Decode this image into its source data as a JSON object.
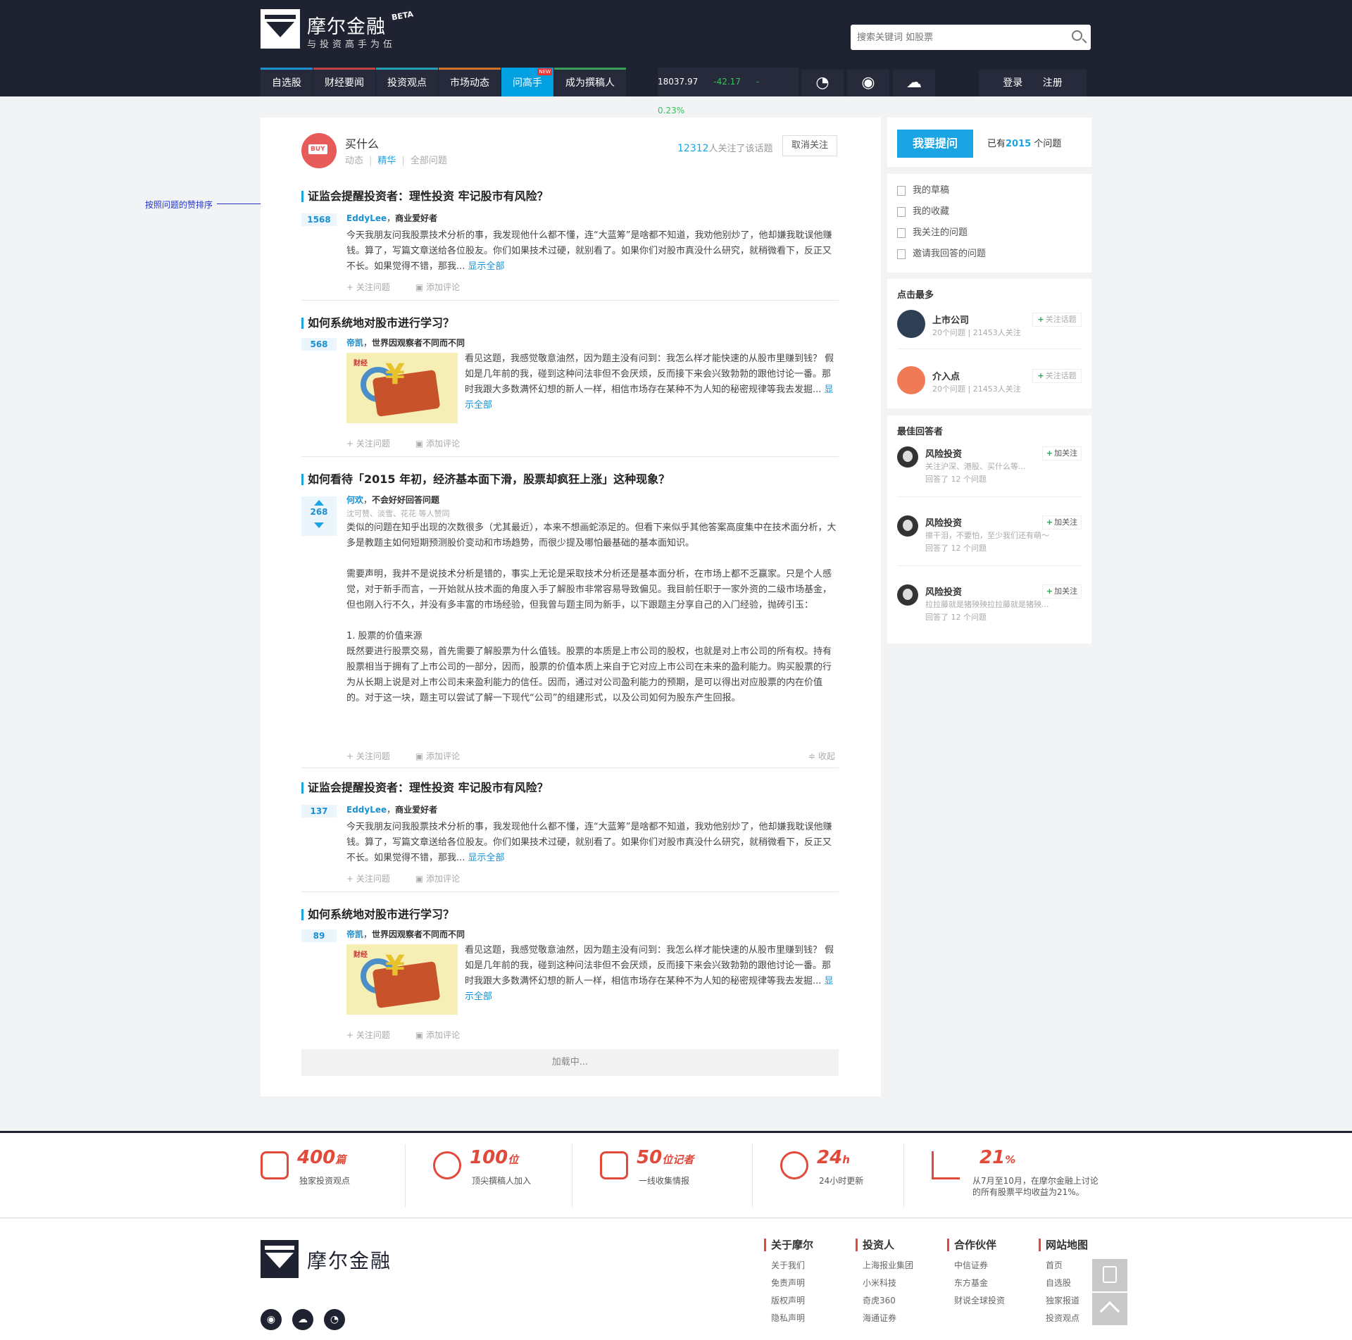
{
  "header": {
    "brand": "摩尔金融",
    "beta": "BETA",
    "slogan": "与投资高手为伍",
    "search_placeholder": "搜索关键词 如股票",
    "nav": [
      "自选股",
      "财经要闻",
      "投资观点",
      "市场动态",
      "问高手",
      "成为撰稿人"
    ],
    "nav_new_badge": "NEW",
    "ticker": {
      "index": "18037.97",
      "change": "-42.17",
      "percent": "-0.23%"
    },
    "login": "登录",
    "register": "注册"
  },
  "topic": {
    "name": "买什么",
    "tabs": [
      "动态",
      "精华",
      "全部问题"
    ],
    "follow_count": "12312",
    "follow_suffix": "人关注了该话题",
    "unfollow": "取消关注"
  },
  "annotation": "按照问题的赞排序",
  "actions": {
    "follow": "关注问题",
    "comment": "添加评论",
    "collapse": "收起",
    "show_all": "显示全部"
  },
  "questions": [
    {
      "title": "证监会提醒投资者：理性投资 牢记股市有风险？",
      "votes": "1568",
      "author": "EddyLee",
      "author_desc": "商业爱好者",
      "text": "今天我朋友问我股票技术分析的事，我发现他什么都不懂，连“大蓝筹”是啥都不知道，我劝他别炒了，他却嫌我耽误他赚钱。算了，写篇文章送给各位股友。你们如果技术过硬，就别看了。如果你们对股市真没什么研究，就稍微看下，反正又不长。如果觉得不错，那我..."
    },
    {
      "title": "如何系统地对股市进行学习？",
      "votes": "568",
      "author": "帝凯",
      "author_desc": "世界因观察者不同而不同",
      "text": "看见这题，我感觉敬意油然，因为题主没有问到：我怎么样才能快速的从股市里赚到钱？ 假如是几年前的我，碰到这种问法非但不会厌烦，反而接下来会兴致勃勃的跟他讨论一番。那时我跟大多数满怀幻想的新人一样，相信市场存在某种不为人知的秘密规律等我去发掘..."
    },
    {
      "title": "如何看待「2015 年初，经济基本面下滑，股票却疯狂上涨」这种现象？",
      "votes": "268",
      "author": "何欢",
      "author_desc": "不会好好回答问题",
      "likers": "沈可赞、淡雪、花花 等人赞同",
      "paragraphs": [
        "类似的问题在知乎出现的次数很多（尤其最近），本来不想画蛇添足的。但看下来似乎其他答案高度集中在技术面分析，大多是教题主如何短期预测股价变动和市场趋势，而很少提及哪怕最基础的基本面知识。",
        "需要声明，我并不是说技术分析是错的，事实上无论是采取技术分析还是基本面分析，在市场上都不乏赢家。只是个人感觉，对于新手而言，一开始就从技术面的角度入手了解股市非常容易导致偏见。我目前任职于一家外资的二级市场基金，但也刚入行不久，并没有多丰富的市场经验，但我曾与题主同为新手，以下跟题主分享自己的入门经验，抛砖引玉：",
        "1. 股票的价值来源",
        "既然要进行股票交易，首先需要了解股票为什么值钱。股票的本质是上市公司的股权，也就是对上市公司的所有权。持有股票相当于拥有了上市公司的一部分，因而，股票的价值本质上来自于它对应上市公司在未来的盈利能力。购买股票的行为从长期上说是对上市公司未来盈利能力的信任。因而，通过对公司盈利能力的预期，是可以得出对应股票的内在价值的。对于这一块，题主可以尝试了解一下现代“公司”的组建形式，以及公司如何为股东产生回报。"
      ]
    },
    {
      "title": "证监会提醒投资者：理性投资 牢记股市有风险？",
      "votes": "137",
      "author": "EddyLee",
      "author_desc": "商业爱好者",
      "text": "今天我朋友问我股票技术分析的事，我发现他什么都不懂，连“大蓝筹”是啥都不知道，我劝他别炒了，他却嫌我耽误他赚钱。算了，写篇文章送给各位股友。你们如果技术过硬，就别看了。如果你们对股市真没什么研究，就稍微看下，反正又不长。如果觉得不错，那我..."
    },
    {
      "title": "如何系统地对股市进行学习？",
      "votes": "89",
      "author": "帝凯",
      "author_desc": "世界因观察者不同而不同",
      "text": "看见这题，我感觉敬意油然，因为题主没有问到：我怎么样才能快速的从股市里赚到钱？ 假如是几年前的我，碰到这种问法非但不会厌烦，反而接下来会兴致勃勃的跟他讨论一番。那时我跟大多数满怀幻想的新人一样，相信市场存在某种不为人知的秘密规律等我去发掘..."
    }
  ],
  "thumb_text": "财经",
  "loading": "加载中...",
  "sidebar": {
    "ask": "我要提问",
    "count_prefix": "已有",
    "count": "2015",
    "count_suffix": " 个问题",
    "mylinks": [
      "我的草稿",
      "我的收藏",
      "我关注的问题",
      "邀请我回答的问题"
    ],
    "hot_title": "点击最多",
    "topics": [
      {
        "name": "上市公司",
        "stats": "20个问题 | 21453人关注",
        "follow": "关注话题"
      },
      {
        "name": "介入点",
        "stats": "20个问题 | 21453人关注",
        "follow": "关注话题"
      }
    ],
    "best_title": "最佳回答者",
    "answerers": [
      {
        "name": "风险投资",
        "desc": "关注沪深、港股、买什么等...",
        "count": "回答了 12 个问题",
        "follow": "加关注"
      },
      {
        "name": "风险投资",
        "desc": "擦干泪，不要怕，至少我们还有萌～",
        "count": "回答了 12 个问题",
        "follow": "加关注"
      },
      {
        "name": "风险投资",
        "desc": "拉拉藤就是猪殃殃拉拉藤就是猪殃...",
        "count": "回答了 12 个问题",
        "follow": "加关注"
      }
    ]
  },
  "stats": [
    {
      "num": "400",
      "unit": "篇",
      "label": "独家投资观点"
    },
    {
      "num": "100",
      "unit": "位",
      "label": "顶尖撰稿人加入"
    },
    {
      "num": "50",
      "unit": "位记者",
      "label": "一线收集情报"
    },
    {
      "num": "24",
      "unit": "h",
      "label": "24小时更新"
    },
    {
      "num": "21",
      "unit": "%",
      "label": "从7月至10月，在摩尔金融上讨论的所有股票平均收益为21%。"
    }
  ],
  "footer": {
    "brand": "摩尔金融",
    "cols": [
      {
        "title": "关于摩尔",
        "links": [
          "关于我们",
          "免责声明",
          "版权声明",
          "隐私声明"
        ]
      },
      {
        "title": "投资人",
        "links": [
          "上海报业集团",
          "小米科技",
          "奇虎360",
          "海通证券"
        ]
      },
      {
        "title": "合作伙伴",
        "links": [
          "中信证券",
          "东方基金",
          "财说全球投资"
        ]
      },
      {
        "title": "网站地图",
        "links": [
          "首页",
          "自选股",
          "独家报道",
          "投资观点"
        ]
      }
    ]
  },
  "colors": {
    "accent": "#1ba4e4",
    "header_bg": "#1f2230",
    "stat_red": "#e14a3b",
    "green": "#3cc05c"
  }
}
